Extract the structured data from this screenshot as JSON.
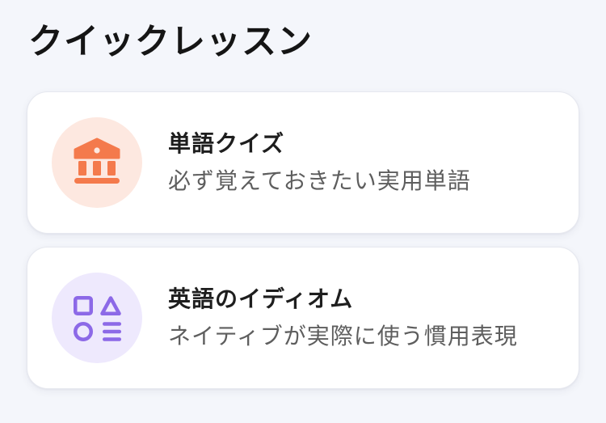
{
  "page": {
    "title": "クイックレッスン"
  },
  "lessons": [
    {
      "title": "単語クイズ",
      "subtitle": "必ず覚えておきたい実用単語",
      "icon": "bank-icon",
      "icon_color": "#f47a4c",
      "icon_bg": "#fde8e0"
    },
    {
      "title": "英語のイディオム",
      "subtitle": "ネイティブが実際に使う慣用表現",
      "icon": "shapes-icon",
      "icon_color": "#8c69e7",
      "icon_bg": "#eee9fd"
    }
  ]
}
